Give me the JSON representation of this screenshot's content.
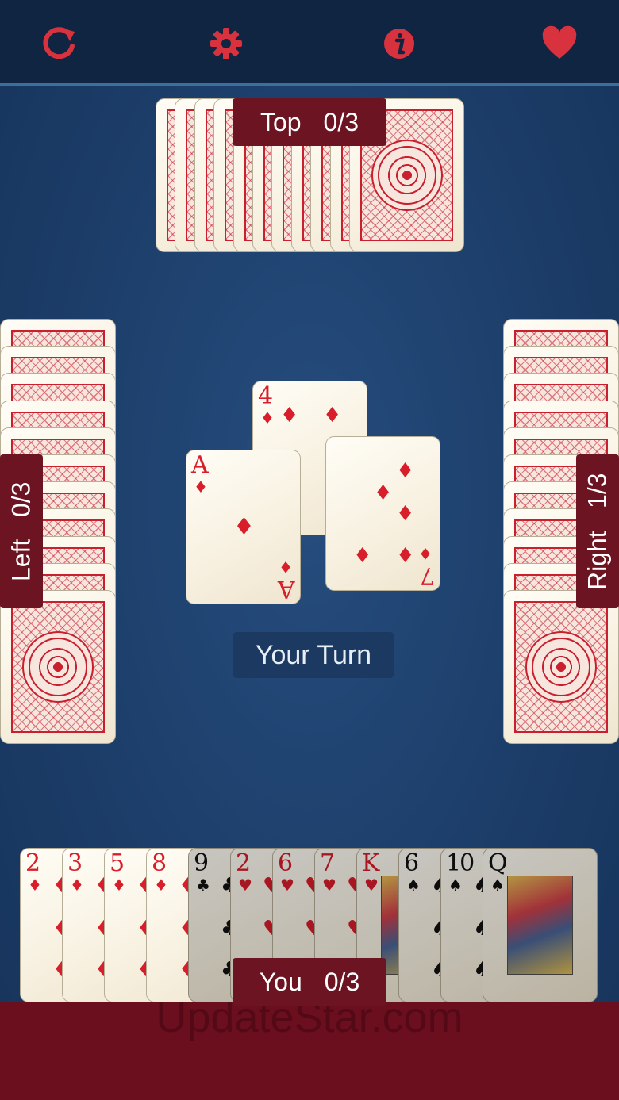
{
  "toolbar": {
    "icons": [
      "refresh-icon",
      "gear-icon",
      "info-icon",
      "heart-icon"
    ],
    "color": "#d8323f"
  },
  "players": {
    "top": {
      "name": "Top",
      "score": "0/3"
    },
    "left": {
      "name": "Left",
      "score": "0/3"
    },
    "right": {
      "name": "Right",
      "score": "1/3"
    },
    "you": {
      "name": "You",
      "score": "0/3"
    }
  },
  "trick": [
    {
      "rank": "4",
      "suit": "♦"
    },
    {
      "rank": "A",
      "suit": "♦"
    },
    {
      "rank": "7",
      "suit": "♦"
    }
  ],
  "status": "Your Turn",
  "hand": [
    {
      "rank": "2",
      "suit": "♦"
    },
    {
      "rank": "3",
      "suit": "♦"
    },
    {
      "rank": "5",
      "suit": "♦"
    },
    {
      "rank": "8",
      "suit": "♦"
    },
    {
      "rank": "9",
      "suit": "♣"
    },
    {
      "rank": "2",
      "suit": "♥"
    },
    {
      "rank": "6",
      "suit": "♥"
    },
    {
      "rank": "7",
      "suit": "♥"
    },
    {
      "rank": "K",
      "suit": "♥"
    },
    {
      "rank": "6",
      "suit": "♠"
    },
    {
      "rank": "10",
      "suit": "♠"
    },
    {
      "rank": "Q",
      "suit": "♠"
    }
  ],
  "watermark": "UpdateStar.com",
  "colors": {
    "table": "#1d3f6b",
    "label_bg": "#6d1422",
    "bottom_bar": "#6b0f1e",
    "suit_red": "#d81e2a"
  }
}
